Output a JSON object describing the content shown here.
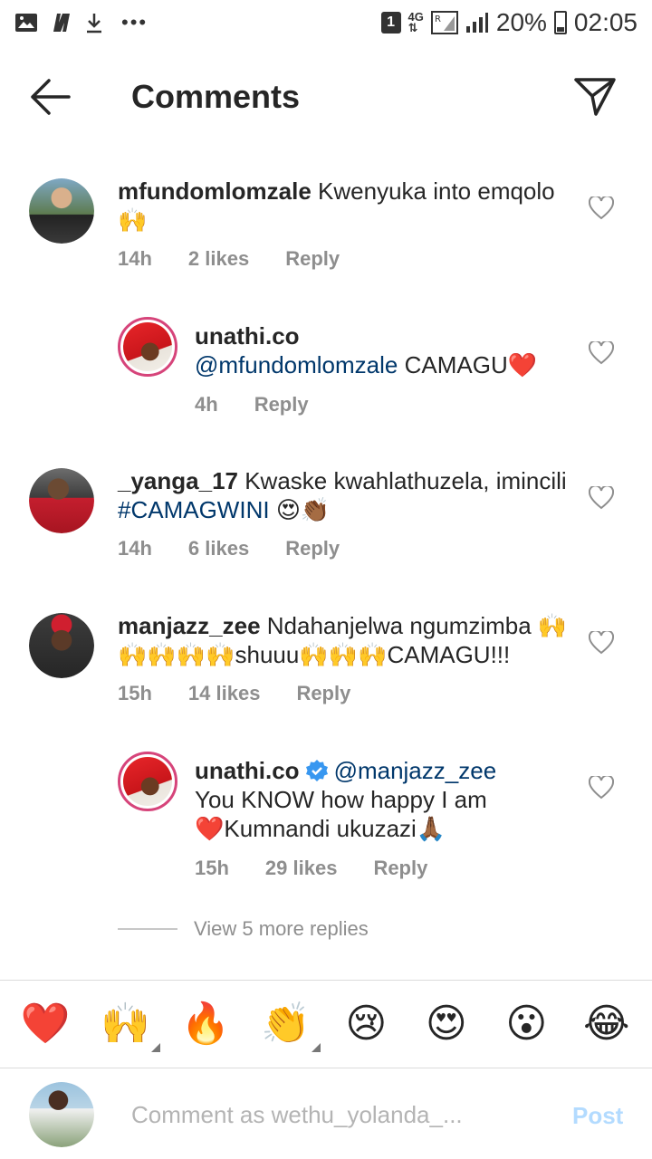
{
  "status_bar": {
    "sim_slot": "1",
    "network": "4G",
    "battery": "20%",
    "time": "02:05"
  },
  "header": {
    "title": "Comments"
  },
  "comments": [
    {
      "username": "mfundomlomzale",
      "text": "Kwenyuka into emqolo🙌",
      "time": "14h",
      "likes": "2 likes",
      "reply": "Reply"
    },
    {
      "username": "unathi.co",
      "mention": "@mfundomlomzale",
      "text": "CAMAGU❤️",
      "time": "4h",
      "reply": "Reply"
    },
    {
      "username": "_yanga_17",
      "text": "Kwaske kwahlathuzela, imincili",
      "hashtag": "#CAMAGWINI",
      "emoji": "😍👏🏾",
      "time": "14h",
      "likes": "6 likes",
      "reply": "Reply"
    },
    {
      "username": "manjazz_zee",
      "text": "Ndahanjelwa ngumzimba 🙌🙌🙌🙌🙌shuuu🙌🙌🙌CAMAGU!!!",
      "time": "15h",
      "likes": "14 likes",
      "reply": "Reply"
    },
    {
      "username": "unathi.co",
      "mention": "@manjazz_zee",
      "text": "You KNOW how happy I am❤️Kumnandi ukuzazi🙏🏾",
      "time": "15h",
      "likes": "29 likes",
      "reply": "Reply"
    }
  ],
  "view_more": "View 5 more replies",
  "emoji_bar": [
    "❤️",
    "🙌",
    "🔥",
    "👏",
    "😢",
    "😍",
    "😮",
    "😂"
  ],
  "compose": {
    "placeholder": "Comment as wethu_yolanda_...",
    "post_label": "Post"
  },
  "colors": {
    "link": "#00376b",
    "muted": "#8e8e8e",
    "post_disabled": "#b3dbff",
    "story_ring": "#d6447a",
    "verified": "#3897f0"
  }
}
